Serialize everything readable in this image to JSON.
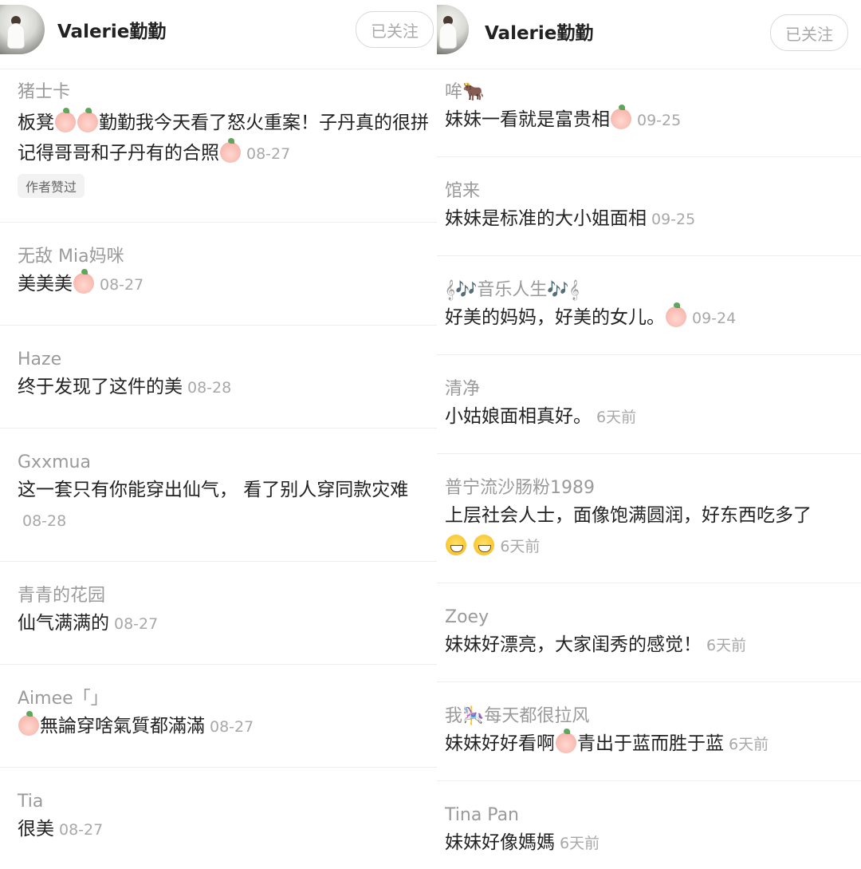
{
  "left": {
    "username": "Valerie勤勤",
    "follow_label": "已关注",
    "comments": [
      {
        "name": "猪士卡",
        "text_parts": [
          "板凳",
          "勤勤我今天看了怒火重案！子丹真的很拼 记得哥哥和子丹有的合照"
        ],
        "date": "08-27",
        "badge": "作者赞过"
      },
      {
        "name": "无敌 Mia妈咪",
        "text": "美美美",
        "date": "08-27"
      },
      {
        "name": "Haze",
        "text": "终于发现了这件的美",
        "date": "08-28"
      },
      {
        "name": "Gxxmua",
        "text": "这一套只有你能穿出仙气， 看了别人穿同款灾难",
        "date": "08-28"
      },
      {
        "name": "青青的花园",
        "text": "仙气满满的",
        "date": "08-27"
      },
      {
        "name": "Aimee「」",
        "text": "無論穿啥氣質都滿滿",
        "date": "08-27"
      },
      {
        "name": "Tia",
        "text": "很美",
        "date": "08-27"
      }
    ]
  },
  "right": {
    "username": "Valerie勤勤",
    "follow_label": "已关注",
    "comments": [
      {
        "name": "哞",
        "name_icon": "🐂",
        "text": "妹妹一看就是富贵相",
        "date": "09-25"
      },
      {
        "name": "馆来",
        "text": "妹妹是标准的大小姐面相",
        "date": "09-25"
      },
      {
        "name": "𝄞🎶音乐人生🎶𝄞",
        "text": "好美的妈妈，好美的女儿。",
        "date": "09-24"
      },
      {
        "name": "清净",
        "text": "小姑娘面相真好。",
        "date": "6天前"
      },
      {
        "name": "普宁流沙肠粉1989",
        "text": "上层社会人士，面像饱满圆润，好东西吃多了",
        "date": "6天前"
      },
      {
        "name": "Zoey",
        "text": "妹妹好漂亮，大家闺秀的感觉！",
        "date": "6天前"
      },
      {
        "name_a": "我",
        "name_icon": "🎠",
        "name_b": "每天都很拉风",
        "text_a": "妹妹好好看啊",
        "text_b": "青出于蓝而胜于蓝",
        "date": "6天前"
      },
      {
        "name": "Tina Pan",
        "text": "妹妹好像媽媽",
        "date": "6天前"
      }
    ]
  },
  "icons": {
    "emoji_face": "peach-face-icon",
    "grin": "grinning-face-icon"
  }
}
